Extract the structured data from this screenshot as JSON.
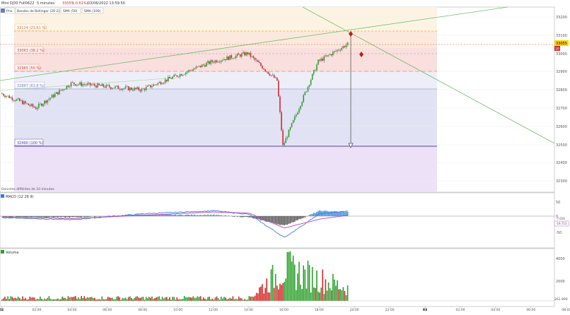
{
  "header": {
    "instrument": "Mini DJ30 Full0622",
    "timeframe": "5 minutes",
    "last_price": "33055",
    "change": "(-0.61%)",
    "datetime": "03/06/2022 13:59:50"
  },
  "legend": {
    "items": [
      {
        "label": "Prix"
      },
      {
        "label": "Bandes de Bollinger (20 2)"
      },
      {
        "label": "SMA (50)"
      },
      {
        "label": "SMA (100)"
      }
    ]
  },
  "price_axis": {
    "labels": [
      "33200",
      "33100",
      "33000",
      "32900",
      "32800",
      "32700",
      "32600",
      "32500",
      "32400",
      "32300"
    ]
  },
  "current_price_badge": {
    "price": "33055",
    "marker": "30"
  },
  "fibo_levels": [
    {
      "label": "33124 (23.61 %)",
      "color": "#f5a25a"
    },
    {
      "label": "33063 (38.2 %)",
      "color": "#e0605a"
    },
    {
      "label": "32965 (50 %)",
      "color": "#e0605a"
    },
    {
      "label": "32867 (61.8 %)",
      "color": "#9aa0d8"
    },
    {
      "label": "32490 (100 %)",
      "color": "#7060c8"
    }
  ],
  "notes": {
    "data_note": "Données différées de 10 minutes"
  },
  "macd_panel": {
    "title": "MACD (12 26 9)",
    "axis_labels": [
      "50",
      "0",
      "-50"
    ],
    "value_badges": [
      "-7.626",
      "-19.713"
    ]
  },
  "volume_panel": {
    "title": "Volume",
    "axis_labels": [
      "4000",
      "2000",
      "261 890"
    ]
  },
  "time_axis": {
    "labels": [
      "02",
      "02:00",
      "04:00",
      "06:00",
      "08:00",
      "10:00",
      "12:00",
      "14:00",
      "16:00",
      "18:00",
      "20:00",
      "22:00",
      "03",
      "02:00",
      "04:00",
      "06:00",
      "08:00",
      "10:00",
      "12:00",
      "14:00",
      "16:00",
      "18:00",
      "20:00",
      "22:00",
      "06",
      "02:00",
      "04:00",
      "06:00",
      "08:00",
      "10:00",
      "12:00"
    ]
  },
  "colors": {
    "up": "#2ca02c",
    "down": "#d62728",
    "macd_line": "#3a7bd5",
    "signal_line": "#c040c0",
    "hist_pos": "#3a8fd8",
    "hist_neg": "#555555",
    "sma50": "#7fc97f",
    "trend": "#6cc26c"
  },
  "chart_data": [
    {
      "type": "candlestick",
      "title": "Mini DJ30 Full0622 - 5 minutes",
      "y_range": [
        32240,
        33290
      ],
      "key_points": [
        {
          "t": "02 00:00",
          "price": 32780
        },
        {
          "t": "02 02:00",
          "price": 32700
        },
        {
          "t": "02 04:00",
          "price": 32835
        },
        {
          "t": "02 08:00",
          "price": 32800
        },
        {
          "t": "02 12:00",
          "price": 32955
        },
        {
          "t": "02 14:00",
          "price": 33000
        },
        {
          "t": "02 15:40",
          "price": 32850
        },
        {
          "t": "02 16:00",
          "price": 32490
        },
        {
          "t": "02 18:00",
          "price": 32955
        },
        {
          "t": "02 20:00",
          "price": 33070
        },
        {
          "t": "02 22:00",
          "price": 33280
        },
        {
          "t": "03 04:00",
          "price": 33280
        },
        {
          "t": "03 08:00",
          "price": 33290
        },
        {
          "t": "03 10:00",
          "price": 33230
        },
        {
          "t": "03 12:00",
          "price": 33150
        },
        {
          "t": "03 13:59",
          "price": 33055
        }
      ],
      "fibonacci": [
        {
          "ratio": "23.61 %",
          "price": 33124
        },
        {
          "ratio": "38.2 %",
          "price": 33063
        },
        {
          "ratio": "50 %",
          "price": 32965
        },
        {
          "ratio": "61.8 %",
          "price": 32867
        },
        {
          "ratio": "100 %",
          "price": 32490
        }
      ],
      "target_arrow": {
        "from": 33160,
        "to": 32490
      }
    },
    {
      "type": "line",
      "title": "MACD (12 26 9)",
      "y_range": [
        -80,
        70
      ],
      "series": [
        {
          "name": "MACD",
          "x": [
            "02 00:00",
            "02 04:00",
            "02 08:00",
            "02 12:00",
            "02 14:00",
            "02 16:00",
            "02 18:00",
            "02 22:00",
            "03 02:00",
            "03 06:00",
            "03 10:00",
            "03 12:00",
            "03 13:59"
          ],
          "values": [
            -5,
            -12,
            8,
            18,
            6,
            -72,
            8,
            30,
            10,
            -5,
            -30,
            -20,
            -20
          ]
        },
        {
          "name": "Signal",
          "x": [
            "02 00:00",
            "02 04:00",
            "02 08:00",
            "02 12:00",
            "02 14:00",
            "02 16:00",
            "02 18:00",
            "02 22:00",
            "03 02:00",
            "03 06:00",
            "03 10:00",
            "03 12:00",
            "03 13:59"
          ],
          "values": [
            -3,
            -8,
            3,
            14,
            10,
            -40,
            -10,
            22,
            18,
            0,
            -15,
            -25,
            -20
          ]
        }
      ]
    },
    {
      "type": "bar",
      "title": "Volume",
      "y_range": [
        0,
        5200
      ],
      "profile": [
        {
          "t": "02 00:00-14:00",
          "volume": 400
        },
        {
          "t": "02 16:00",
          "volume": 4300
        },
        {
          "t": "02 17:00",
          "volume": 3600
        },
        {
          "t": "02 20:00",
          "volume": 1400
        },
        {
          "t": "02 22:00",
          "volume": 2600
        },
        {
          "t": "03 00:00-13:59",
          "volume": 600
        }
      ]
    }
  ]
}
